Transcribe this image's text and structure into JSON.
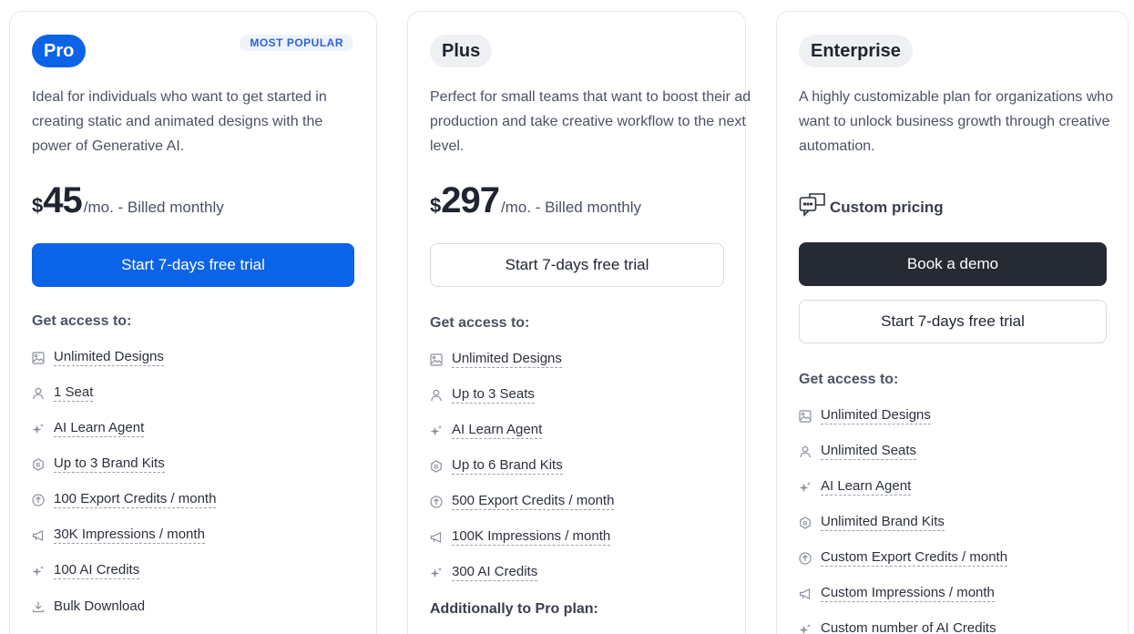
{
  "colors": {
    "accent": "#0b63e8",
    "dark_button": "#262a33",
    "badge_bg": "#eef3fd"
  },
  "pro": {
    "name": "Pro",
    "badge": "MOST POPULAR",
    "description": "Ideal for individuals who want to get started in creating static and animated designs with the power of Generative AI.",
    "currency": "$",
    "price": "45",
    "period": "/mo. - Billed monthly",
    "cta": "Start 7-days free trial",
    "access_heading": "Get access to:",
    "features": [
      {
        "icon": "image-icon",
        "label": "Unlimited Designs"
      },
      {
        "icon": "user-icon",
        "label": "1 Seat"
      },
      {
        "icon": "sparkle-icon",
        "label": "AI Learn Agent"
      },
      {
        "icon": "brand-kit-icon",
        "label": "Up to 3 Brand Kits"
      },
      {
        "icon": "export-icon",
        "label": "100 Export Credits / month"
      },
      {
        "icon": "megaphone-icon",
        "label": "30K Impressions / month"
      },
      {
        "icon": "sparkle-icon",
        "label": "100 AI Credits"
      },
      {
        "icon": "download-icon",
        "label": "Bulk Download"
      }
    ]
  },
  "plus": {
    "name": "Plus",
    "description": "Perfect for small teams that want to boost their ad production and take creative workflow to the next level.",
    "currency": "$",
    "price": "297",
    "period": "/mo. - Billed monthly",
    "cta": "Start 7-days free trial",
    "access_heading": "Get access to:",
    "features": [
      {
        "icon": "image-icon",
        "label": "Unlimited Designs"
      },
      {
        "icon": "user-icon",
        "label": "Up to 3 Seats"
      },
      {
        "icon": "sparkle-icon",
        "label": "AI Learn Agent"
      },
      {
        "icon": "brand-kit-icon",
        "label": "Up to 6 Brand Kits"
      },
      {
        "icon": "export-icon",
        "label": "500 Export Credits / month"
      },
      {
        "icon": "megaphone-icon",
        "label": "100K Impressions / month"
      },
      {
        "icon": "sparkle-icon",
        "label": "300 AI Credits"
      }
    ],
    "additional_heading": "Additionally to Pro plan:"
  },
  "enterprise": {
    "name": "Enterprise",
    "description": "A highly customizable plan for organizations who want to unlock business growth through creative automation.",
    "pricing_label": "Custom pricing",
    "demo_cta": "Book a demo",
    "cta": "Start 7-days free trial",
    "access_heading": "Get access to:",
    "features": [
      {
        "icon": "image-icon",
        "label": "Unlimited Designs"
      },
      {
        "icon": "user-icon",
        "label": "Unlimited Seats"
      },
      {
        "icon": "sparkle-icon",
        "label": "AI Learn Agent"
      },
      {
        "icon": "brand-kit-icon",
        "label": "Unlimited Brand Kits"
      },
      {
        "icon": "export-icon",
        "label": "Custom Export Credits / month"
      },
      {
        "icon": "megaphone-icon",
        "label": "Custom Impressions / month"
      },
      {
        "icon": "sparkle-icon",
        "label": "Custom number of AI Credits"
      }
    ]
  }
}
